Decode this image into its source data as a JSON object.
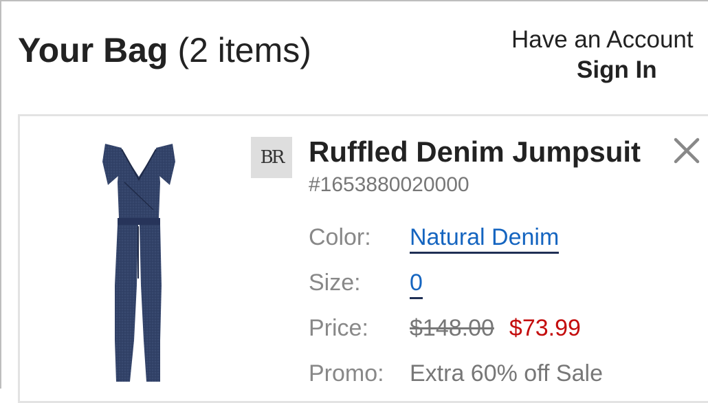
{
  "header": {
    "title_bold": "Your Bag",
    "title_count": "(2 items)",
    "account_prompt": "Have an Account",
    "sign_in": "Sign In"
  },
  "item": {
    "brand_logo": "BR",
    "name": "Ruffled Denim Jumpsuit",
    "sku": "#1653880020000",
    "color_label": "Color:",
    "color_value": "Natural Denim",
    "size_label": "Size:",
    "size_value": "0",
    "price_label": "Price:",
    "original_price": "$148.00",
    "sale_price": "$73.99",
    "promo_label": "Promo:",
    "promo_value": "Extra 60% off Sale",
    "image_icon": "jumpsuit-image",
    "remove_icon": "close-icon"
  },
  "colors": {
    "link": "#1565c0",
    "sale": "#c40d0d",
    "muted": "#777777",
    "jumpsuit": "#2f3e63"
  }
}
